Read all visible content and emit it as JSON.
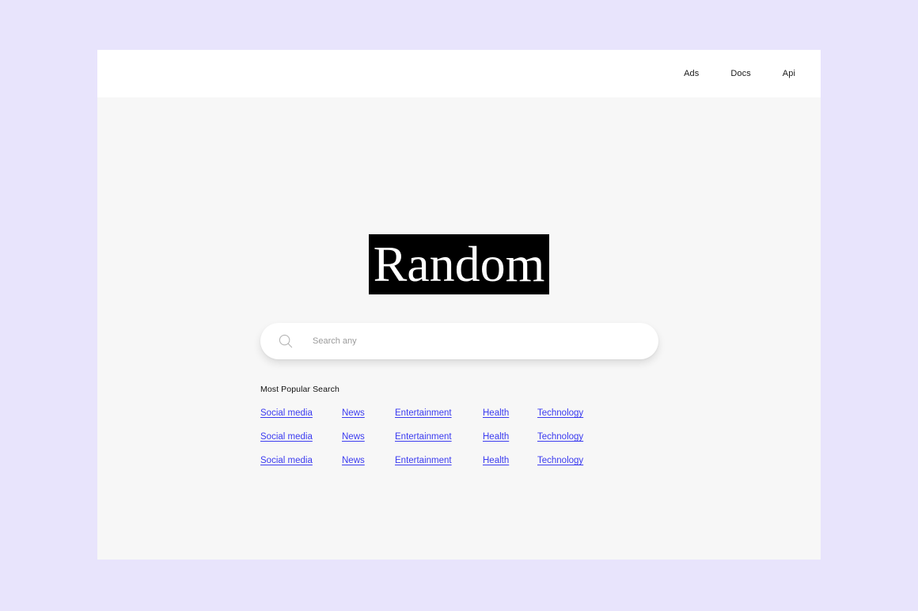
{
  "theme": {
    "page_background": "#e8e4fc",
    "card_background": "#f7f7f7",
    "header_background": "#ffffff",
    "logo_background": "#000000",
    "logo_text_color": "#ffffff",
    "link_color": "#3b3bf0",
    "placeholder_color": "#9b9b9b"
  },
  "header": {
    "nav": [
      {
        "label": "Ads"
      },
      {
        "label": "Docs"
      },
      {
        "label": "Api"
      }
    ]
  },
  "hero": {
    "logo_text": "Random"
  },
  "search": {
    "placeholder": "Search any",
    "value": "",
    "icon": "search-icon"
  },
  "popular": {
    "title": "Most Popular Search",
    "rows": [
      {
        "items": [
          {
            "label": "Social media"
          },
          {
            "label": "News"
          },
          {
            "label": "Entertainment"
          },
          {
            "label": "Health"
          },
          {
            "label": "Technology"
          }
        ]
      },
      {
        "items": [
          {
            "label": "Social media"
          },
          {
            "label": "News"
          },
          {
            "label": "Entertainment"
          },
          {
            "label": "Health"
          },
          {
            "label": "Technology"
          }
        ]
      },
      {
        "items": [
          {
            "label": "Social media"
          },
          {
            "label": "News"
          },
          {
            "label": "Entertainment"
          },
          {
            "label": "Health"
          },
          {
            "label": "Technology"
          }
        ]
      }
    ]
  }
}
